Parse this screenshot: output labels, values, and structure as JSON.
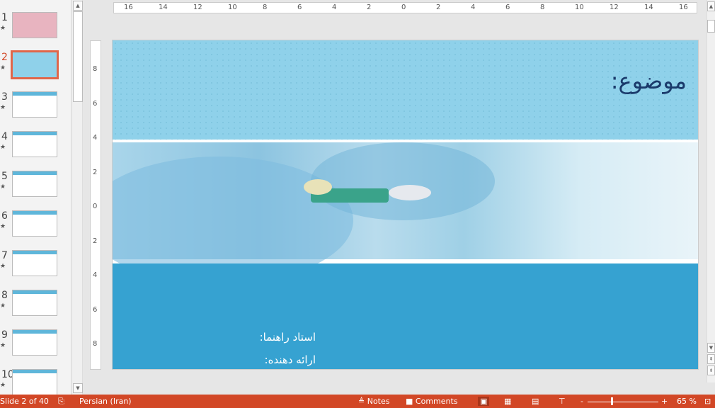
{
  "thumbnails": [
    {
      "num": "1",
      "star": "★",
      "bg": "#e8b4c0"
    },
    {
      "num": "2",
      "star": "★",
      "bg": "#8fd1ea",
      "active": true
    },
    {
      "num": "3",
      "star": "★",
      "bg": "#ffffff"
    },
    {
      "num": "4",
      "star": "★",
      "bg": "#ffffff"
    },
    {
      "num": "5",
      "star": "★",
      "bg": "#ffffff"
    },
    {
      "num": "6",
      "star": "★",
      "bg": "#ffffff"
    },
    {
      "num": "7",
      "star": "★",
      "bg": "#ffffff"
    },
    {
      "num": "8",
      "star": "★",
      "bg": "#ffffff"
    },
    {
      "num": "9",
      "star": "★",
      "bg": "#ffffff"
    },
    {
      "num": "10",
      "star": "★",
      "bg": "#ffffff"
    }
  ],
  "hruler": [
    "16",
    "14",
    "12",
    "10",
    "8",
    "6",
    "4",
    "2",
    "0",
    "2",
    "4",
    "6",
    "8",
    "10",
    "12",
    "14",
    "16"
  ],
  "vruler": [
    "8",
    "6",
    "4",
    "2",
    "0",
    "2",
    "4",
    "6",
    "8"
  ],
  "slide": {
    "title": "موضوع:",
    "advisor": "استاد راهنما:",
    "presenter": "ارائه دهنده:"
  },
  "status": {
    "slide": "Slide 2 of 40",
    "language": "Persian (Iran)",
    "notes": "Notes",
    "comments": "Comments",
    "zoom": "65 %",
    "zoom_level_percent": 65
  },
  "colors": {
    "status_bar": "#d24726",
    "accent": "#e0664a"
  }
}
